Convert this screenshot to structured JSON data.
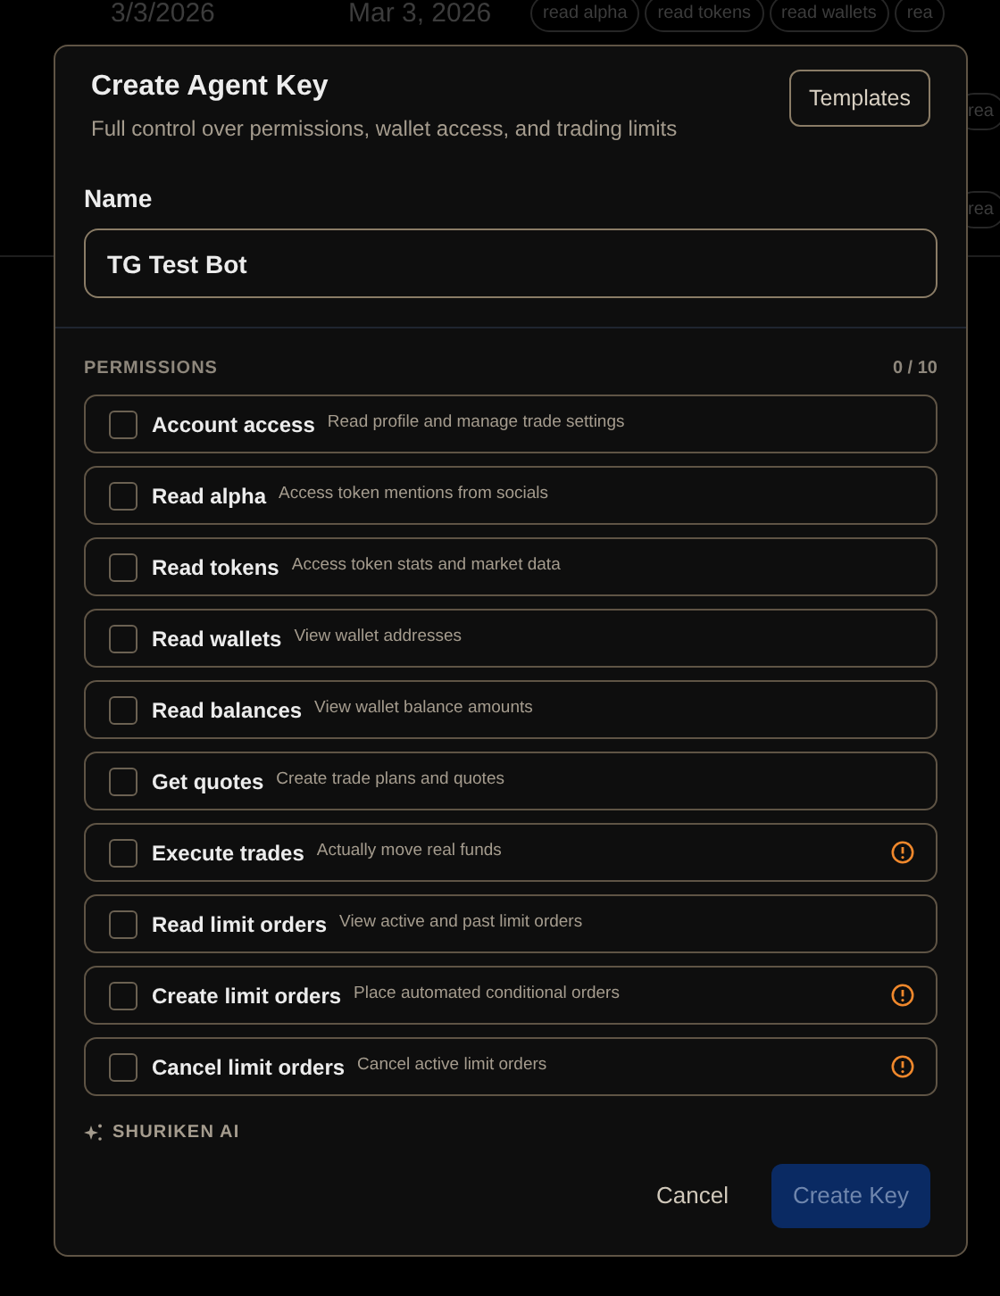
{
  "background_table": {
    "rows": [
      {
        "column_1": "3/3/2026",
        "column_2": "Mar 3, 2026",
        "tags": [
          "read alpha",
          "read tokens",
          "read wallets",
          "rea"
        ]
      },
      {
        "tags": [
          "rea"
        ]
      },
      {
        "tags": [
          "rea"
        ]
      }
    ]
  },
  "dialog": {
    "title": "Create Agent Key",
    "subtitle": "Full control over permissions, wallet access, and trading limits",
    "templates_button": "Templates",
    "name_label": "Name",
    "name_value": "TG Test Bot",
    "permissions_label": "PERMISSIONS",
    "permissions_count": "0 / 10",
    "permissions": [
      {
        "name": "Account access",
        "description": "Read profile and manage trade settings",
        "checked": false,
        "warning": false
      },
      {
        "name": "Read alpha",
        "description": "Access token mentions from socials",
        "checked": false,
        "warning": false
      },
      {
        "name": "Read tokens",
        "description": "Access token stats and market data",
        "checked": false,
        "warning": false
      },
      {
        "name": "Read wallets",
        "description": "View wallet addresses",
        "checked": false,
        "warning": false
      },
      {
        "name": "Read balances",
        "description": "View wallet balance amounts",
        "checked": false,
        "warning": false
      },
      {
        "name": "Get quotes",
        "description": "Create trade plans and quotes",
        "checked": false,
        "warning": false
      },
      {
        "name": "Execute trades",
        "description": "Actually move real funds",
        "checked": false,
        "warning": true
      },
      {
        "name": "Read limit orders",
        "description": "View active and past limit orders",
        "checked": false,
        "warning": false
      },
      {
        "name": "Create limit orders",
        "description": "Place automated conditional orders",
        "checked": false,
        "warning": true
      },
      {
        "name": "Cancel limit orders",
        "description": "Cancel active limit orders",
        "checked": false,
        "warning": true
      }
    ],
    "brand": "SHURIKEN AI",
    "cancel_button": "Cancel",
    "create_button": {
      "label": "Create Key",
      "disabled": true
    }
  }
}
